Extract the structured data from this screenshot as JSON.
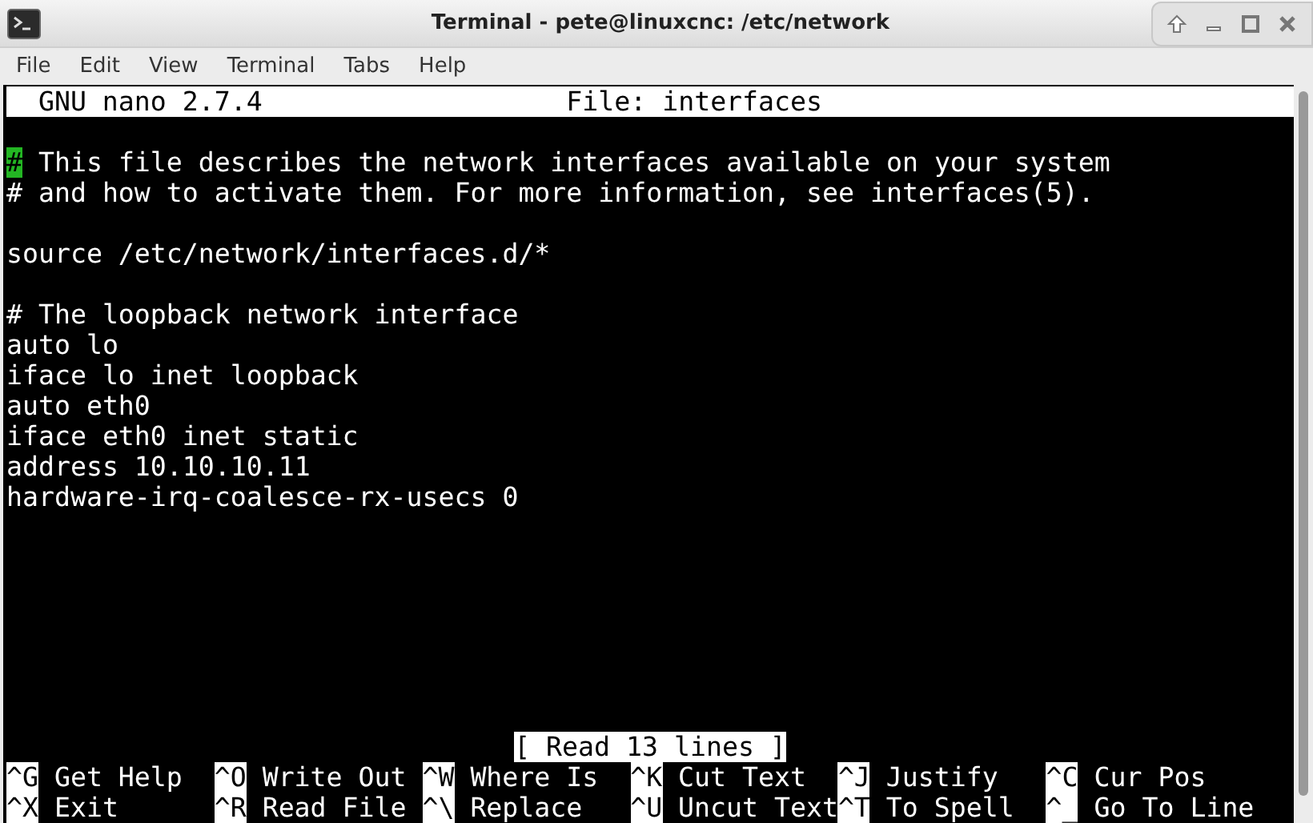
{
  "window": {
    "title": "Terminal - pete@linuxcnc: /etc/network"
  },
  "menu": [
    "File",
    "Edit",
    "View",
    "Terminal",
    "Tabs",
    "Help"
  ],
  "nano": {
    "version": "GNU nano 2.7.4",
    "file": "File: interfaces"
  },
  "blocks": [
    [
      {
        "text": "# This file describes the network interfaces available on your system",
        "cursor": true
      },
      {
        "text": "# and how to activate them. For more information, see interfaces(5).",
        "cursor": false
      }
    ],
    [
      {
        "text": "source /etc/network/interfaces.d/*",
        "cursor": false
      }
    ],
    [
      {
        "text": "# The loopback network interface",
        "cursor": false
      },
      {
        "text": "auto lo",
        "cursor": false
      },
      {
        "text": "iface lo inet loopback",
        "cursor": false
      },
      {
        "text": "auto eth0",
        "cursor": false
      },
      {
        "text": "iface eth0 inet static",
        "cursor": false
      },
      {
        "text": "address 10.10.10.11",
        "cursor": false
      },
      {
        "text": "hardware-irq-coalesce-rx-usecs 0",
        "cursor": false
      }
    ]
  ],
  "status": "[ Read 13 lines ]",
  "shortcuts": [
    [
      {
        "key": "^G",
        "label": "Get Help"
      },
      {
        "key": "^O",
        "label": "Write Out"
      },
      {
        "key": "^W",
        "label": "Where Is"
      },
      {
        "key": "^K",
        "label": "Cut Text"
      },
      {
        "key": "^J",
        "label": "Justify"
      },
      {
        "key": "^C",
        "label": "Cur Pos"
      }
    ],
    [
      {
        "key": "^X",
        "label": "Exit"
      },
      {
        "key": "^R",
        "label": "Read File"
      },
      {
        "key": "^\\",
        "label": "Replace"
      },
      {
        "key": "^U",
        "label": "Uncut Text"
      },
      {
        "key": "^T",
        "label": "To Spell"
      },
      {
        "key": "^_",
        "label": "Go To Line"
      }
    ]
  ]
}
